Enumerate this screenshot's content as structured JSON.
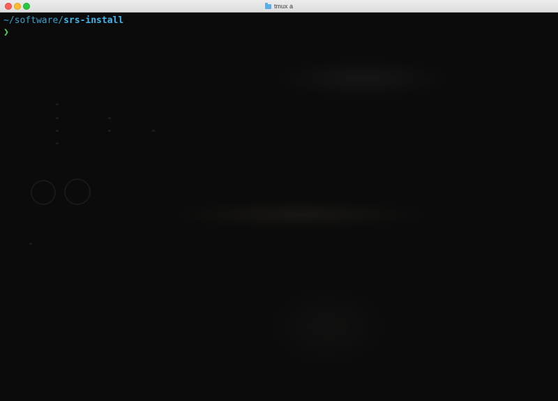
{
  "window": {
    "title": "tmux a",
    "title_icon": "folder-icon"
  },
  "terminal": {
    "prompt_path_prefix": "~/software/",
    "prompt_path_current": "srs-install",
    "prompt_symbol": "❯"
  },
  "colors": {
    "path": "#3aa0cc",
    "path_current": "#3fb6ee",
    "prompt_symbol": "#4fdc4f",
    "background": "#0b0b0b"
  }
}
